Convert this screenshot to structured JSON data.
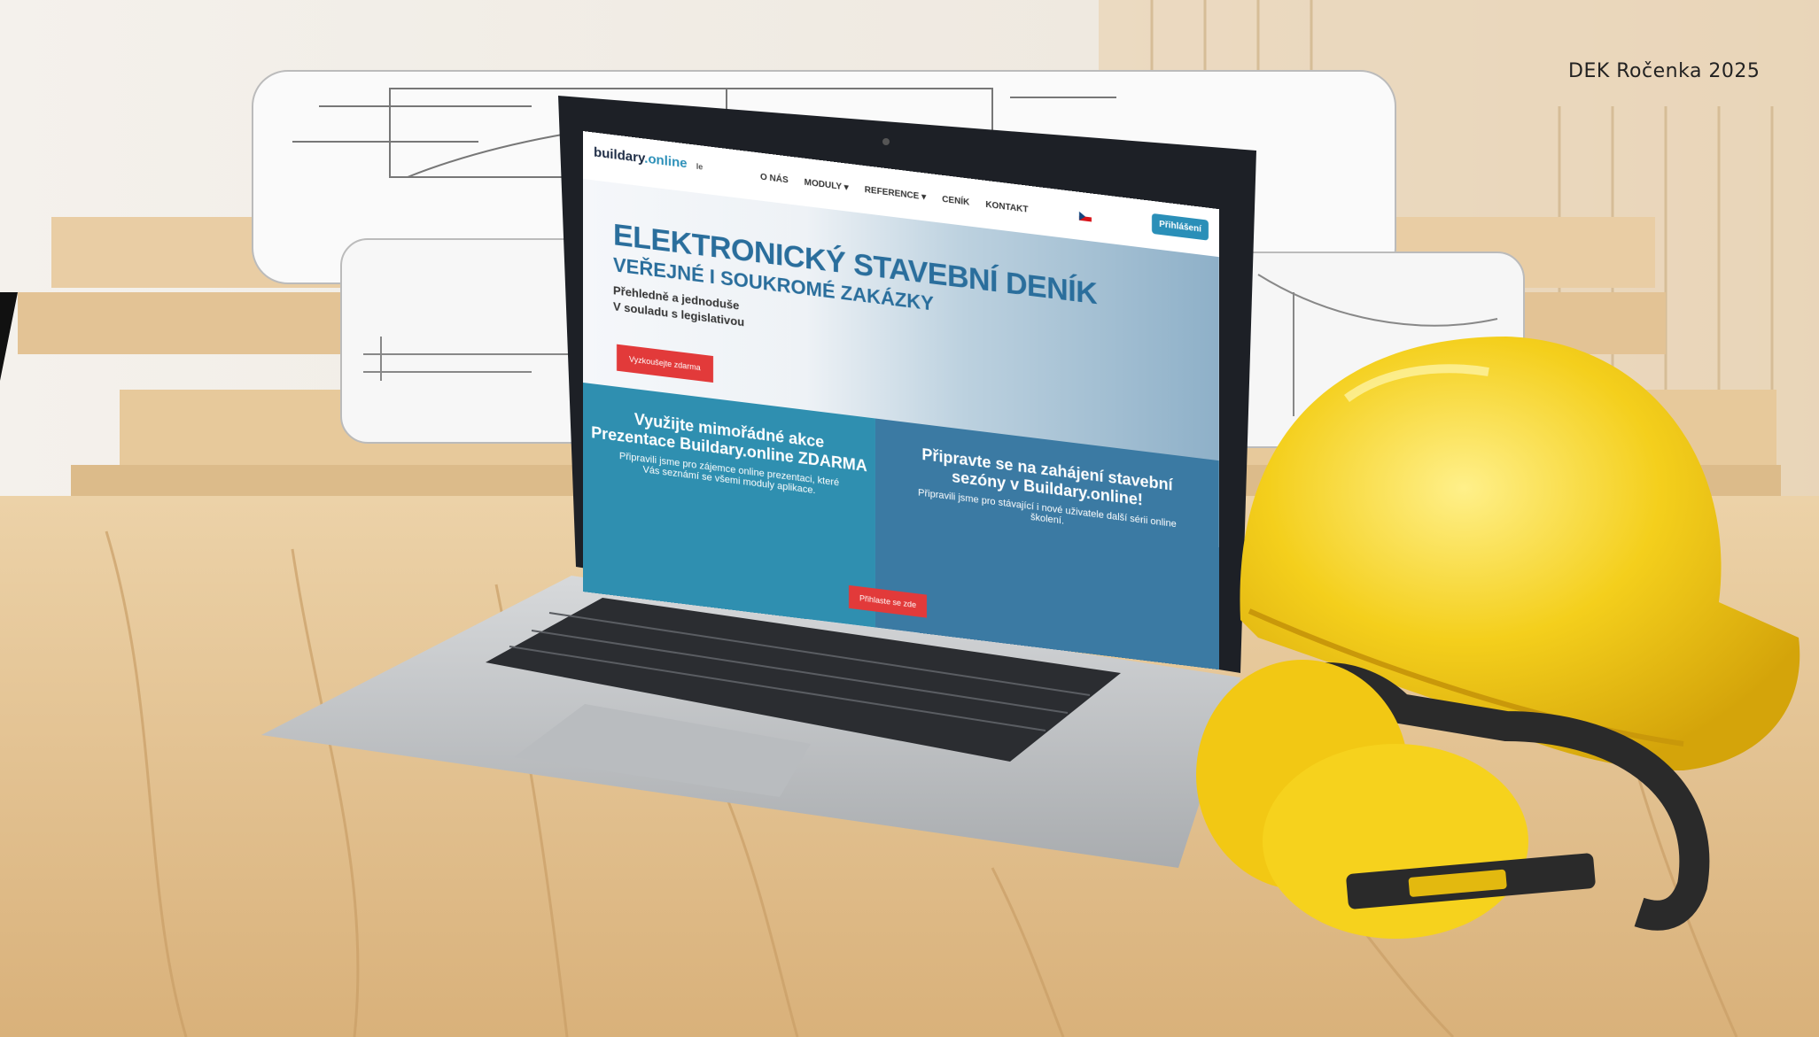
{
  "overlay": {
    "label": "DEK Ročenka 2025"
  },
  "website": {
    "logo": {
      "brand": "buildary",
      "suffix": ".online",
      "extra": "le"
    },
    "nav": [
      "O NÁS",
      "MODULY ▾",
      "REFERENCE ▾",
      "CENÍK",
      "KONTAKT"
    ],
    "login_label": "Přihlášení",
    "hero": {
      "title": "ELEKTRONICKÝ STAVEBNÍ DENÍK",
      "subtitle": "VEŘEJNÉ I SOUKROMÉ ZAKÁZKY",
      "line1": "Přehledně a jednoduše",
      "line2": "V souladu s legislativou",
      "button_label": "Vyzkoušejte zdarma"
    },
    "promo_left": {
      "heading1": "Využijte mimořádné akce",
      "heading2": "Prezentace Buildary.online ZDARMA",
      "body": "Připravili jsme pro zájemce online prezentaci, které Vás seznámí se všemi moduly aplikace."
    },
    "promo_right": {
      "heading1": "Připravte se na zahájení stavební",
      "heading2": "sezóny v Buildary.online!",
      "body": "Připravili jsme pro stávající i nové uživatele další sérii online školení."
    },
    "bottom_button_label": "Přihlaste se zde"
  },
  "colors": {
    "accent_blue": "#2a8fb8",
    "title_blue": "#2a6e9c",
    "cta_red": "#e23a3a",
    "helmet_yellow": "#f3cb1a",
    "wood": "#e8c99c"
  },
  "icons": [
    "buildary-logo-icon",
    "czech-flag-icon"
  ]
}
